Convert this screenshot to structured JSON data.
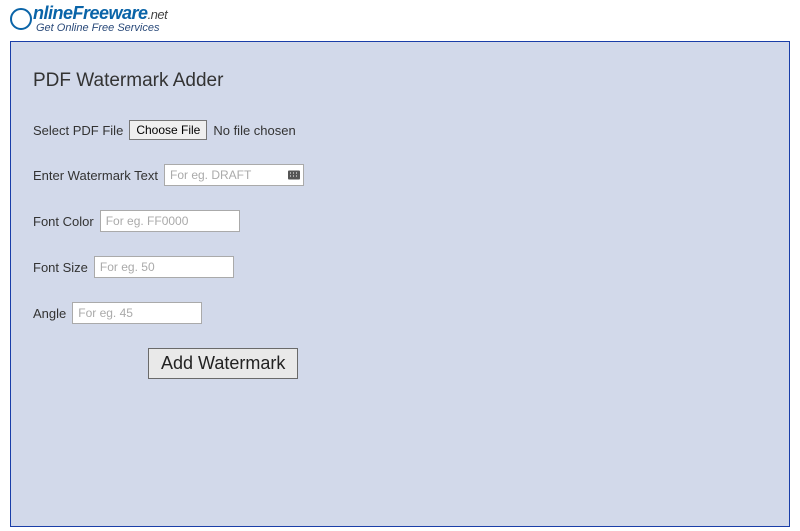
{
  "header": {
    "logo_name": "nlineFreeware",
    "logo_tld": ".net",
    "tagline": "Get Online Free Services"
  },
  "page": {
    "title": "PDF Watermark Adder"
  },
  "fields": {
    "file": {
      "label": "Select PDF File",
      "button": "Choose File",
      "status": "No file chosen"
    },
    "watermark": {
      "label": "Enter Watermark Text",
      "placeholder": "For eg. DRAFT",
      "value": ""
    },
    "fontcolor": {
      "label": "Font Color",
      "placeholder": "For eg. FF0000",
      "value": ""
    },
    "fontsize": {
      "label": "Font Size",
      "placeholder": "For eg. 50",
      "value": ""
    },
    "angle": {
      "label": "Angle",
      "placeholder": "For eg. 45",
      "value": ""
    }
  },
  "actions": {
    "submit": "Add Watermark"
  }
}
